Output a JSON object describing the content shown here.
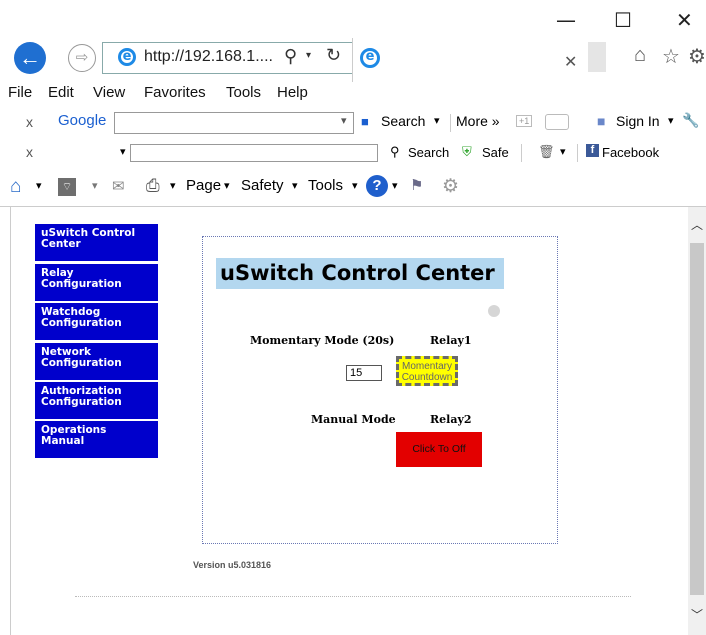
{
  "window": {
    "minimize": "—",
    "maximize": "☐",
    "close": "✕"
  },
  "browser": {
    "address": "http://192.168.1....",
    "nav_icons": [
      "back-arrow-icon",
      "forward-arrow-icon",
      "search-icon",
      "refresh-icon",
      "home-icon",
      "star-icon"
    ]
  },
  "menu": [
    "File",
    "Edit",
    "View",
    "Favorites",
    "Tools",
    "Help"
  ],
  "google_bar": {
    "close": "x",
    "brand": "Google",
    "search_label": "Search",
    "more_label": "More »",
    "sign_in": "Sign In"
  },
  "toolbar3": {
    "close": "x",
    "search_label": "Search",
    "safe_label": "Safe",
    "facebook_label": "Facebook"
  },
  "command_bar": {
    "page": "Page",
    "safety": "Safety",
    "tools": "Tools"
  },
  "sidebar": {
    "items": [
      {
        "line1": "uSwitch Control",
        "line2": "Center"
      },
      {
        "line1": "Relay",
        "line2": "Configuration"
      },
      {
        "line1": "Watchdog",
        "line2": "Configuration"
      },
      {
        "line1": "Network",
        "line2": "Configuration"
      },
      {
        "line1": "Authorization",
        "line2": "Configuration"
      },
      {
        "line1": "Operations",
        "line2": "Manual"
      }
    ]
  },
  "main": {
    "title": "uSwitch Control Center",
    "momentary_label": "Momentary Mode (20s)",
    "relay1_label": "Relay1",
    "countdown_value": "15",
    "relay1_button": {
      "line1": "Momentary",
      "line2": "Countdown"
    },
    "manual_label": "Manual Mode",
    "relay2_label": "Relay2",
    "relay2_button": "Click To Off",
    "version": "Version u5.031816"
  },
  "colors": {
    "nav_bg": "#0000cc",
    "title_bg": "#b3d7ef",
    "relay1_bg": "#ffff00",
    "relay2_bg": "#e30000",
    "ie_blue": "#1f6fd1"
  }
}
